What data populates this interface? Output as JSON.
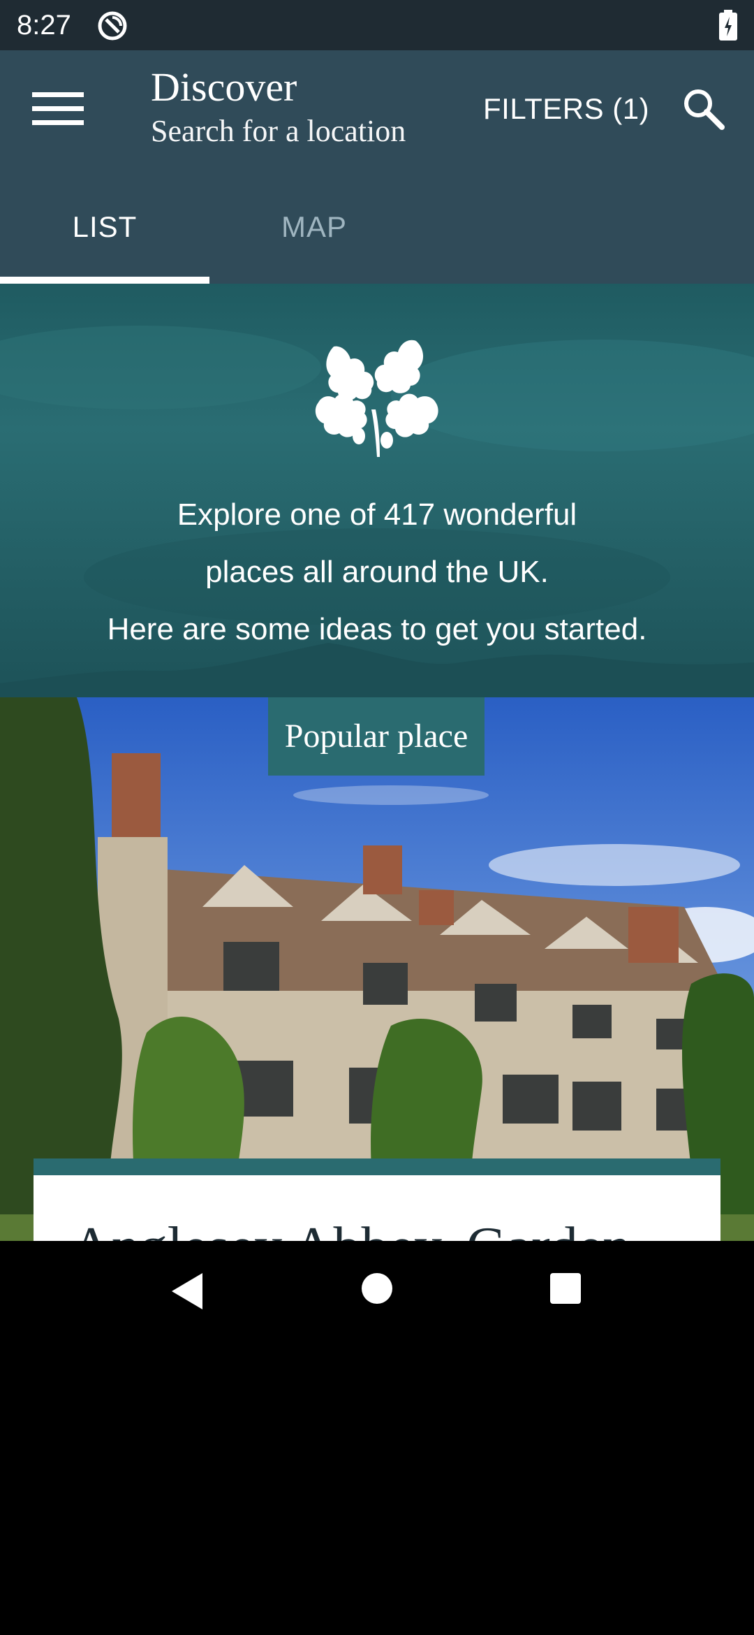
{
  "status_bar": {
    "time": "8:27",
    "app_icon": "sync-icon",
    "battery_icon": "battery-charging-icon"
  },
  "app_bar": {
    "menu_icon": "hamburger-menu-icon",
    "title": "Discover",
    "subtitle": "Search for a location",
    "filters_label": "FILTERS (1)",
    "search_icon": "search-icon",
    "background_color": "#304b59"
  },
  "tabs": [
    {
      "label": "LIST",
      "selected": true
    },
    {
      "label": "MAP",
      "selected": false
    }
  ],
  "intro": {
    "logo_icon": "oak-leaf-icon",
    "lines": [
      "Explore one of 417 wonderful",
      "places all around the UK.",
      "Here are some ideas to get you started."
    ],
    "background_color": "#2a6d73"
  },
  "feature": {
    "badge": "Popular place",
    "title": "Anglesey Abbey, Garden",
    "accent_color": "#2a6b70"
  },
  "nav_bar": {
    "back_icon": "back-triangle-icon",
    "home_icon": "home-circle-icon",
    "recents_icon": "recents-square-icon"
  }
}
